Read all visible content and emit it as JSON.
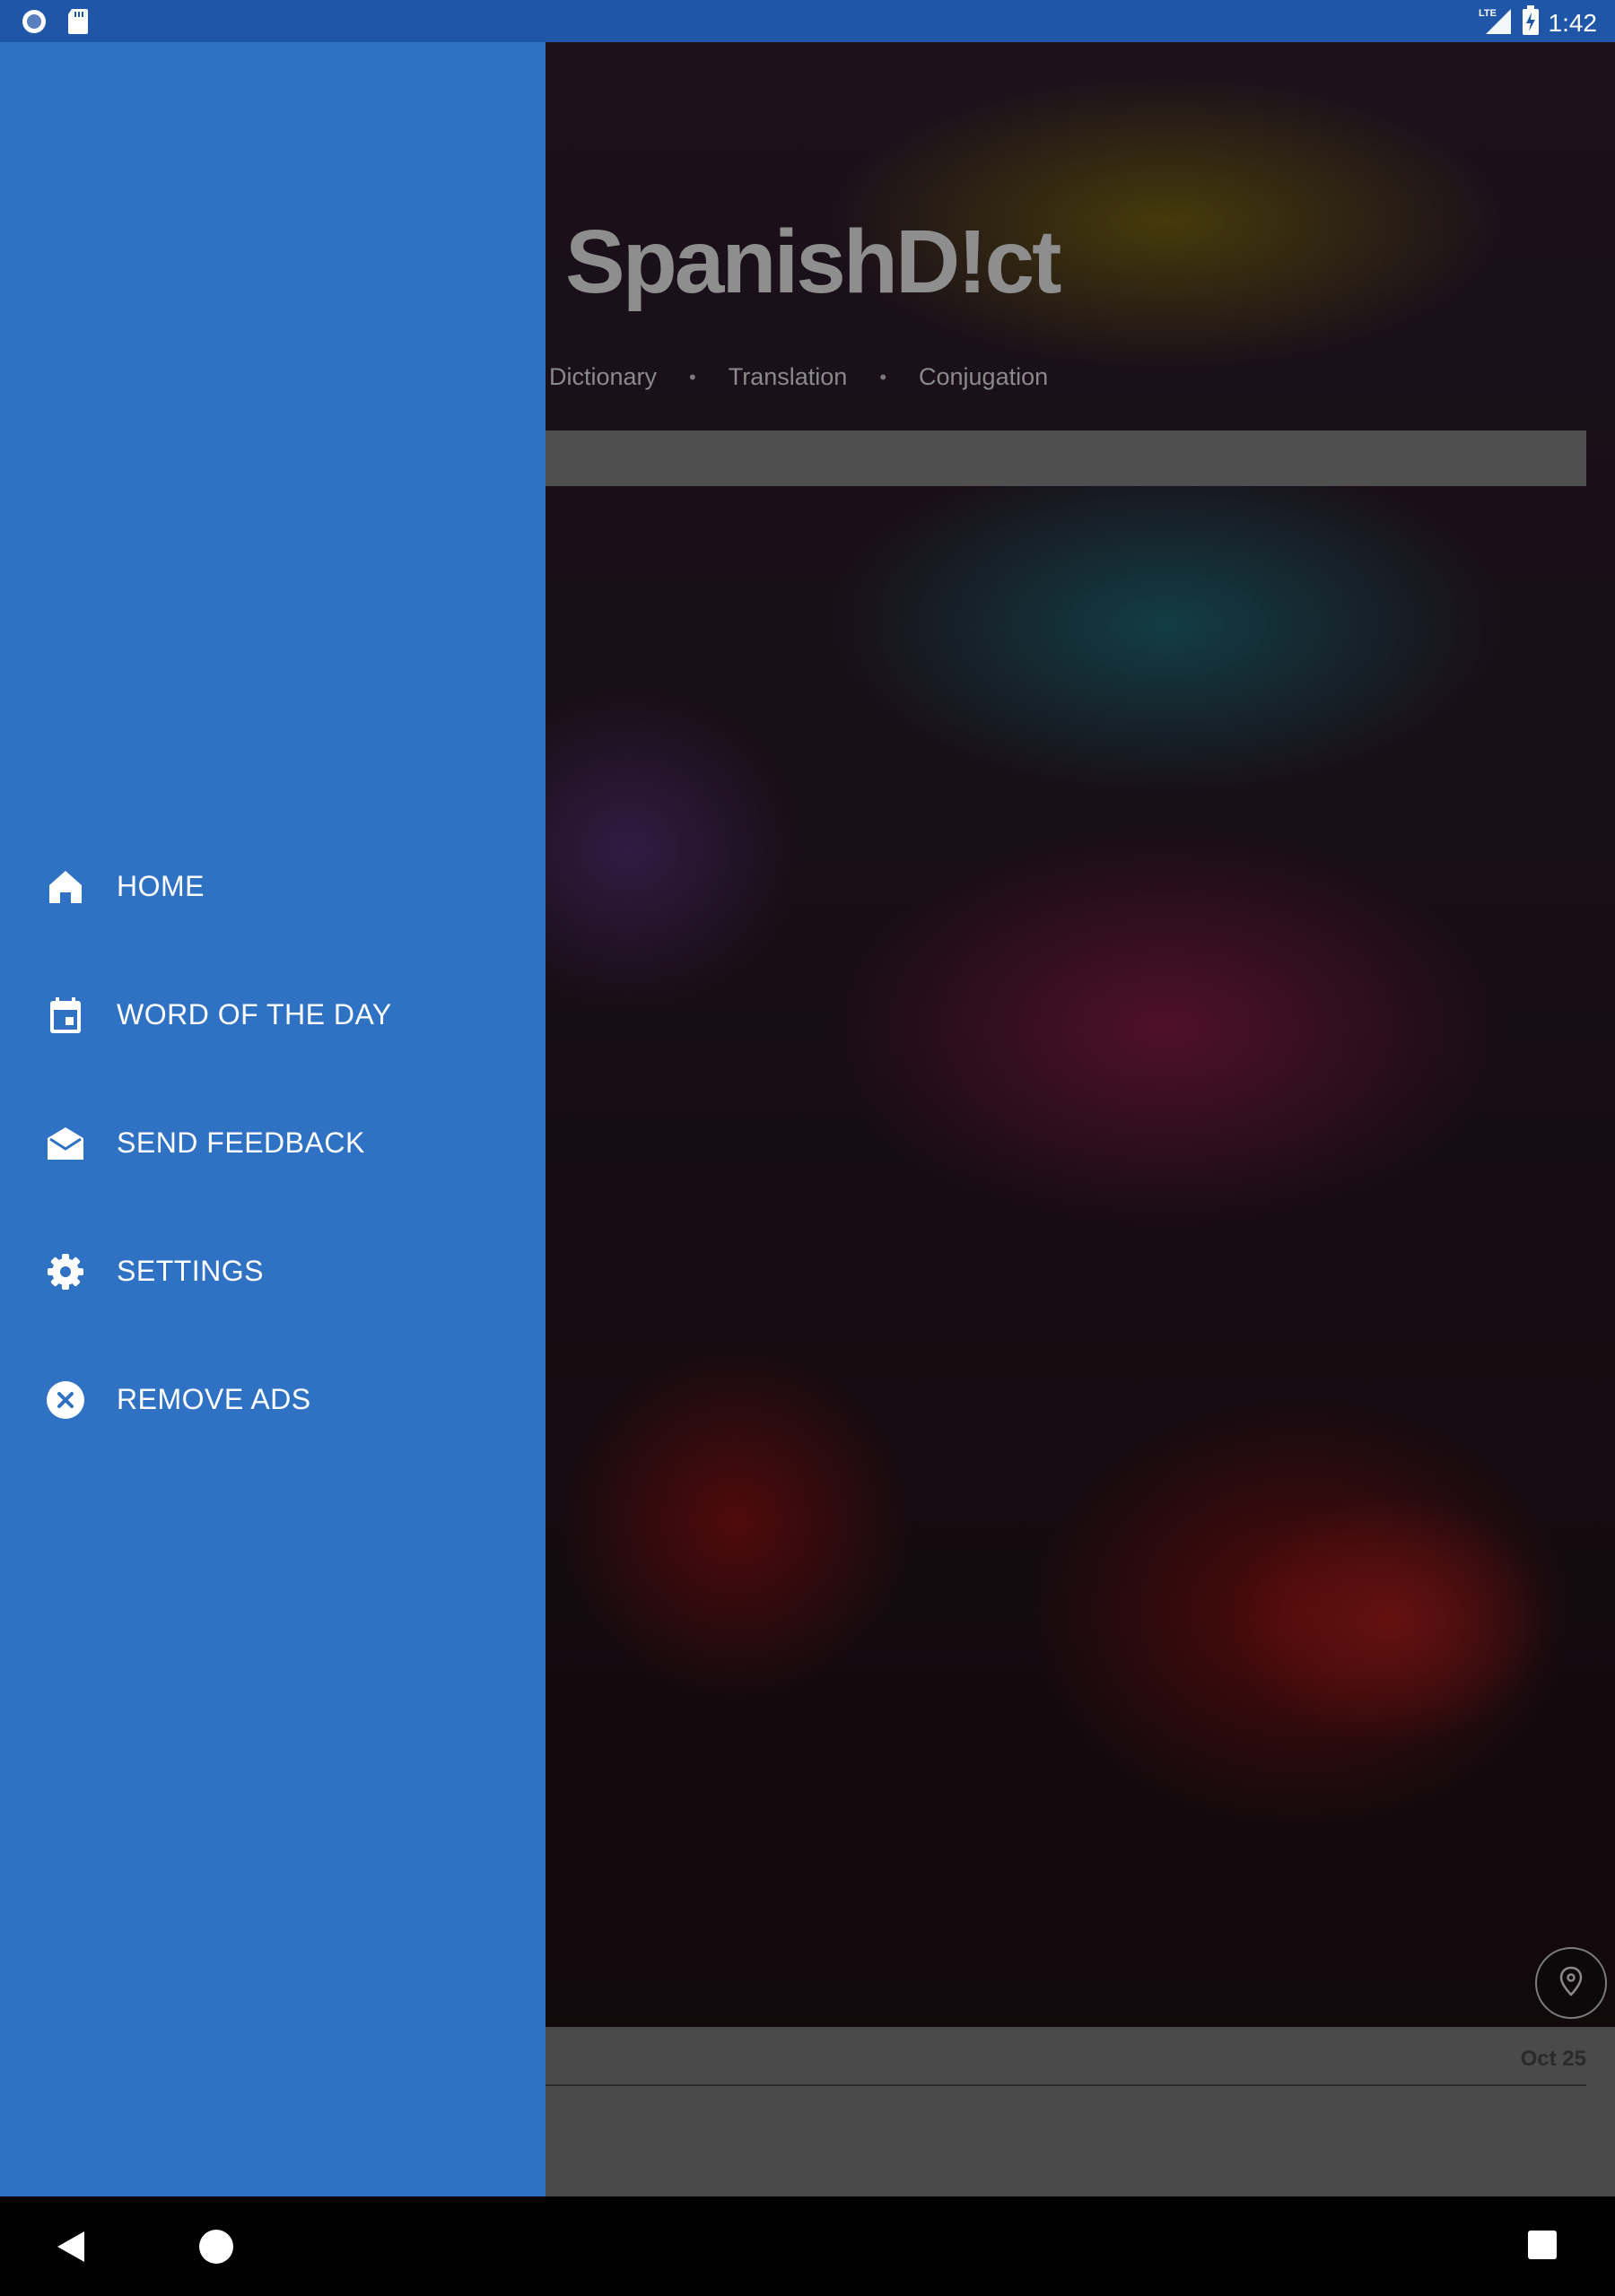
{
  "status_bar": {
    "time": "1:42",
    "network": "LTE",
    "icons": [
      "record-icon",
      "sd-card-icon",
      "lte-signal-icon",
      "battery-charging-icon"
    ]
  },
  "header": {
    "brand": "SpanishD!ct",
    "nav": [
      "Dictionary",
      "Translation",
      "Conjugation"
    ],
    "nav_separator": "•"
  },
  "content": {
    "card_date": "Oct 25"
  },
  "drawer": {
    "background": "#2f71c3",
    "items": [
      {
        "label": "HOME",
        "icon": "home-icon"
      },
      {
        "label": "WORD OF THE DAY",
        "icon": "calendar-icon"
      },
      {
        "label": "SEND FEEDBACK",
        "icon": "mail-open-icon"
      },
      {
        "label": "SETTINGS",
        "icon": "gear-icon"
      },
      {
        "label": "REMOVE ADS",
        "icon": "close-circle-icon"
      }
    ]
  },
  "nav_bar": {
    "buttons": [
      "back",
      "home",
      "recents"
    ]
  }
}
